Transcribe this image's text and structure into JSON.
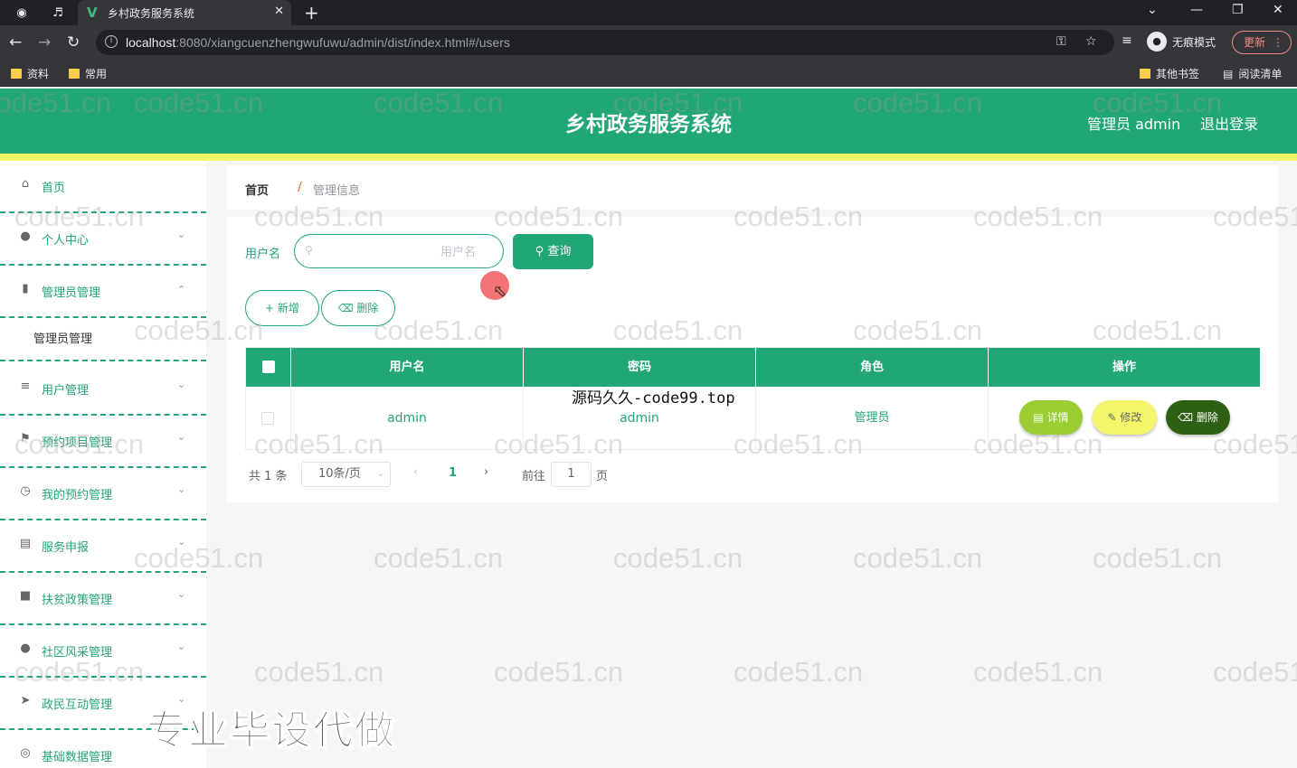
{
  "browser": {
    "tab_title": "乡村政务服务系统",
    "url_host": "localhost",
    "url_rest": ":8080/xiangcuenzhengwufuwu/admin/dist/index.html#/users",
    "profile_label": "无痕模式",
    "update_label": "更新",
    "bookmarks": {
      "left": [
        "资料",
        "常用"
      ],
      "other": "其他书签",
      "reading_list": "阅读清单"
    }
  },
  "header": {
    "title": "乡村政务服务系统",
    "user": "管理员 admin",
    "logout": "退出登录"
  },
  "sidebar": {
    "items": [
      {
        "label": "首页",
        "icon": "home-icon"
      },
      {
        "label": "个人中心",
        "icon": "user-icon"
      },
      {
        "label": "管理员管理",
        "icon": "book-icon"
      },
      {
        "label": "管理员管理",
        "sub": true
      },
      {
        "label": "用户管理",
        "icon": "list-icon"
      },
      {
        "label": "预约项目管理",
        "icon": "flag-icon"
      },
      {
        "label": "我的预约管理",
        "icon": "clock-icon"
      },
      {
        "label": "服务申报",
        "icon": "chat-icon"
      },
      {
        "label": "扶贫政策管理",
        "icon": "sign-icon"
      },
      {
        "label": "社区风采管理",
        "icon": "brush-icon"
      },
      {
        "label": "政民互动管理",
        "icon": "send-icon"
      },
      {
        "label": "基础数据管理",
        "icon": "globe-icon"
      }
    ]
  },
  "breadcrumb": {
    "home": "首页",
    "current": "管理信息"
  },
  "search": {
    "label": "用户名",
    "placeholder": "用户名",
    "button": "查询"
  },
  "actions": {
    "add": "新增",
    "delete": "删除"
  },
  "table": {
    "headers": [
      "用户名",
      "密码",
      "角色",
      "操作"
    ],
    "rows": [
      {
        "username": "admin",
        "password": "admin",
        "role": "管理员"
      }
    ],
    "row_actions": {
      "detail": "详情",
      "edit": "修改",
      "delete": "删除"
    }
  },
  "pagination": {
    "total": "共 1 条",
    "page_size": "10条/页",
    "current_page": "1",
    "goto_label": "前往",
    "goto_value": "1",
    "page_suffix": "页"
  },
  "overlays": {
    "watermark": "code51.cn",
    "caption": "源码久久-code99.top",
    "promo": "专业毕设代做"
  },
  "colors": {
    "primary": "#21a675",
    "accent_yellow": "#f4f563",
    "detail": "#9acd32",
    "edit": "#f3f56a",
    "delete": "#2e5f12"
  }
}
